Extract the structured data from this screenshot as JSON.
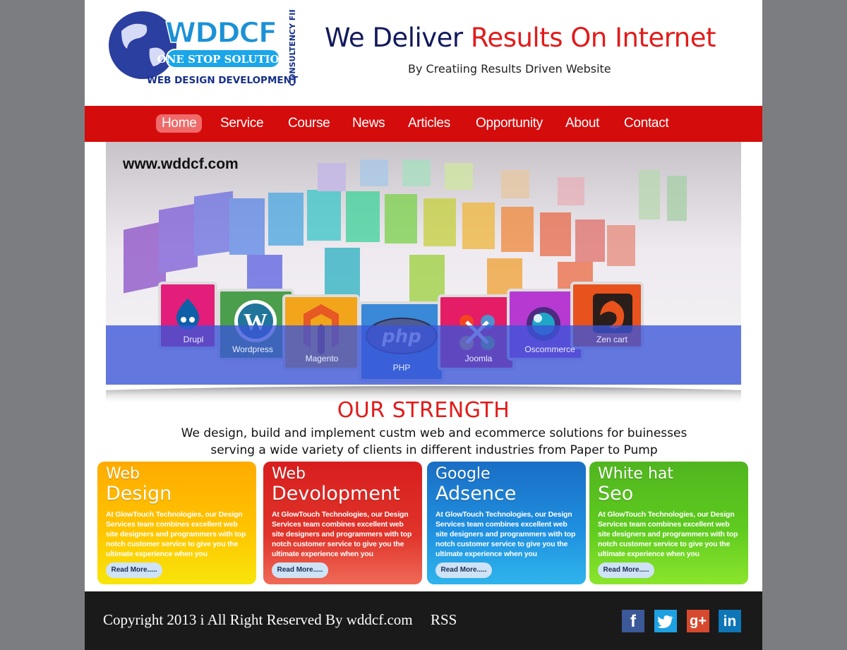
{
  "header": {
    "logo_main": "WDDCF",
    "logo_tagline": "ONE STOP SOLUTION",
    "logo_sub": "WEB DESIGN DEVELOPMENT",
    "logo_side": "CONSULTENCY FIRM",
    "headline_part1": "We Deliver ",
    "headline_part2": "Results On Internet",
    "subline": "By Creatiing Results Driven Website"
  },
  "nav": {
    "items": [
      {
        "label": "Home"
      },
      {
        "label": "Service"
      },
      {
        "label": "Course"
      },
      {
        "label": "News"
      },
      {
        "label": "Articles"
      },
      {
        "label": "Opportunity"
      },
      {
        "label": "About"
      },
      {
        "label": "Contact"
      }
    ],
    "active": "Home"
  },
  "banner": {
    "url": "www.wddcf.com",
    "tiles": [
      {
        "label": "Drupl"
      },
      {
        "label": "Wordpress"
      },
      {
        "label": "Magento"
      },
      {
        "label": "PHP",
        "logo": "php"
      },
      {
        "label": "Joomla"
      },
      {
        "label": "Oscommerce"
      },
      {
        "label": "Zen cart"
      }
    ]
  },
  "strength": {
    "title": "OUR STRENGTH",
    "line1": "We design, build and implement custm web and ecommerce solutions for buinesses",
    "line2": "serving a wide variety of clients in different industries from Paper to Pump"
  },
  "cards": [
    {
      "title1": "Web",
      "title2": "Design",
      "body": "At GlowTouch Technologies, our Design Services team combines excellent web site designers and programmers with top notch customer service to give you the ultimate experience when you",
      "button": "Read More....."
    },
    {
      "title1": "Web",
      "title2": "Devolopment",
      "body": "At GlowTouch Technologies, our Design Services team combines excellent web site designers and programmers with top notch customer service to give you the ultimate experience when you",
      "button": "Read More....."
    },
    {
      "title1": "Google",
      "title2": "Adsence",
      "body": "At GlowTouch Technologies, our Design Services team combines excellent web site designers and programmers with top notch customer service to give you the ultimate experience when you",
      "button": "Read More....."
    },
    {
      "title1": "White hat",
      "title2": "Seo",
      "body": "At GlowTouch Technologies, our Design Services team combines excellent web site designers and programmers with top notch customer service to give you the ultimate experience when you",
      "button": "Read More....."
    }
  ],
  "footer": {
    "copyright": "Copyright 2013 i All Right Reserved By wddcf.com",
    "rss": "RSS",
    "social": [
      {
        "name": "facebook-icon",
        "glyph": "f",
        "color": "#3b5998"
      },
      {
        "name": "twitter-icon",
        "glyph": "",
        "color": "#1da1e2"
      },
      {
        "name": "google-plus-icon",
        "glyph": "g+",
        "color": "#d6492f"
      },
      {
        "name": "linkedin-icon",
        "glyph": "in",
        "color": "#0e76b6"
      }
    ]
  },
  "colors": {
    "brand_red": "#d40c0c",
    "headline_navy": "#121a5b",
    "headline_red": "#e11b1b",
    "background_gray": "#7c7d80",
    "footer_black": "#1b1a1a"
  }
}
